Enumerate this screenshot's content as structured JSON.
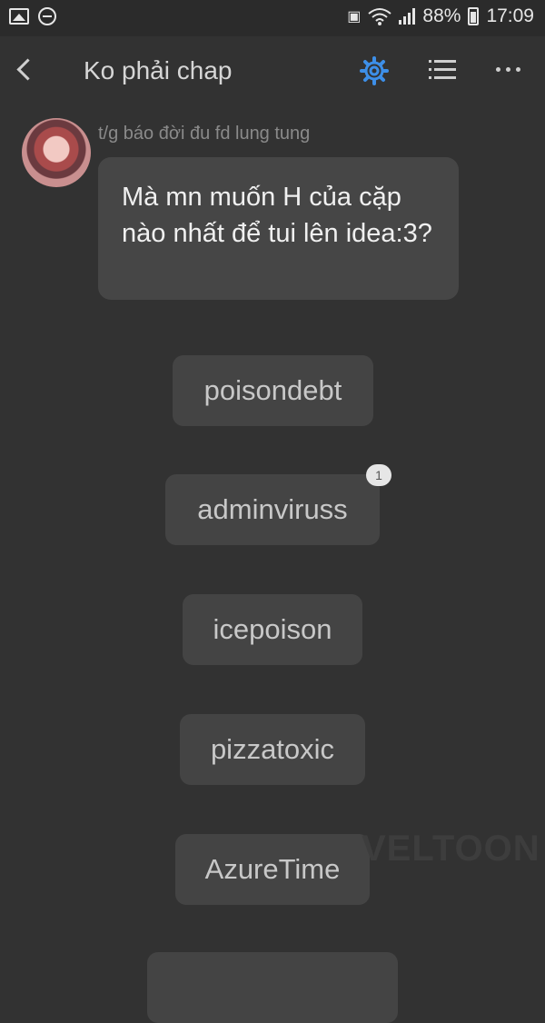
{
  "status_bar": {
    "battery": "88%",
    "time": "17:09"
  },
  "header": {
    "title": "Ko phải chap",
    "accent_color": "#3d8fe8"
  },
  "message": {
    "author": "t/g báo đời đu fd lung tung",
    "text": "Mà mn muốn H của cặp nào nhất để tui lên idea:3?"
  },
  "options": [
    {
      "label": "poisondebt"
    },
    {
      "label": "adminviruss",
      "badge": "1"
    },
    {
      "label": "icepoison"
    },
    {
      "label": "pizzatoxic"
    },
    {
      "label": "AzureTime"
    }
  ],
  "watermark": "VELTOON"
}
